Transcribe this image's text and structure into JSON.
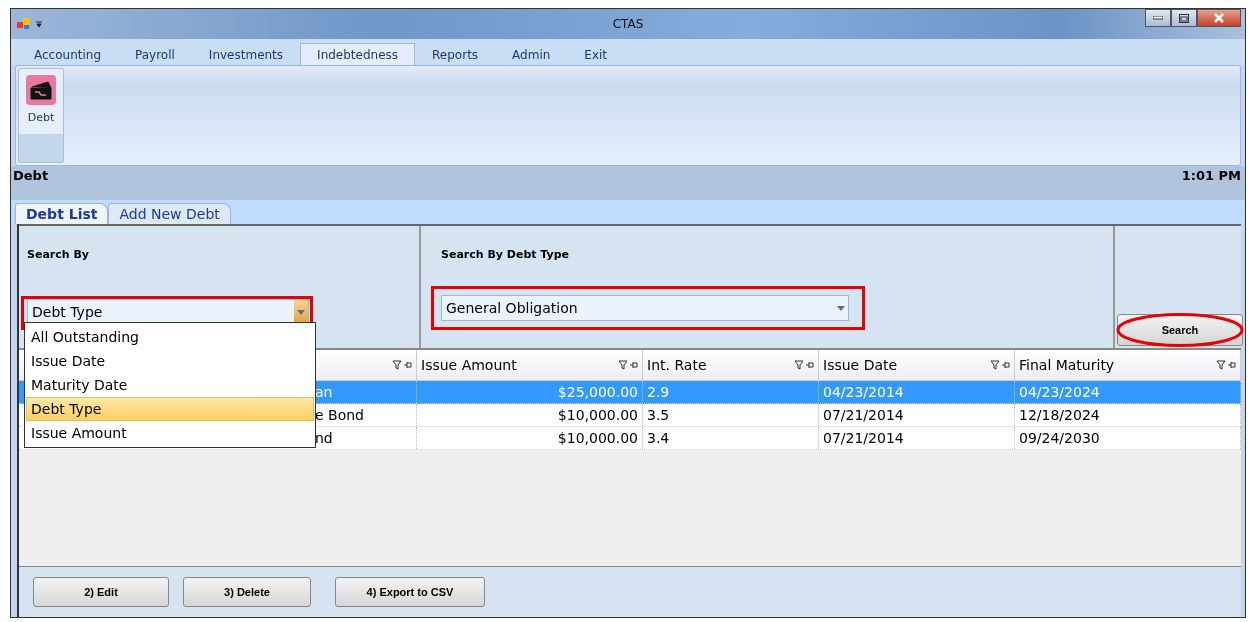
{
  "window": {
    "title": "CTAS"
  },
  "menu_tabs": [
    {
      "label": "Accounting",
      "selected": false
    },
    {
      "label": "Payroll",
      "selected": false
    },
    {
      "label": "Investments",
      "selected": false
    },
    {
      "label": "Indebtedness",
      "selected": true
    },
    {
      "label": "Reports",
      "selected": false
    },
    {
      "label": "Admin",
      "selected": false
    },
    {
      "label": "Exit",
      "selected": false
    }
  ],
  "ribbon": {
    "buttons": [
      {
        "label": "Debt"
      }
    ]
  },
  "header": {
    "title": "Debt",
    "time": "1:01 PM"
  },
  "tabs": [
    {
      "label": "Debt List",
      "selected": true
    },
    {
      "label": "Add New Debt",
      "selected": false
    }
  ],
  "search_by": {
    "label": "Search By",
    "value": "Debt Type",
    "highlighted": true,
    "expanded": true,
    "options": [
      {
        "label": "All Outstanding",
        "selected": false
      },
      {
        "label": "Issue Date",
        "selected": false
      },
      {
        "label": "Maturity Date",
        "selected": false
      },
      {
        "label": "Debt Type",
        "selected": true
      },
      {
        "label": "Issue Amount",
        "selected": false
      }
    ]
  },
  "search_by_debt_type": {
    "label": "Search By Debt Type",
    "value": "General Obligation",
    "highlighted": true
  },
  "search_button": {
    "label": "Search",
    "highlighted": true
  },
  "table": {
    "columns": [
      "",
      "Issue Amount",
      "Int. Rate",
      "Issue Date",
      "Final Maturity"
    ],
    "rows": [
      {
        "selected": true,
        "cells": [
          "an",
          "$25,000.00",
          "2.9",
          "04/23/2014",
          "04/23/2024"
        ]
      },
      {
        "selected": false,
        "cells": [
          "e Bond",
          "$10,000.00",
          "3.5",
          "07/21/2014",
          "12/18/2024"
        ]
      },
      {
        "selected": false,
        "cells": [
          "nd",
          "$10,000.00",
          "3.4",
          "07/21/2014",
          "09/24/2030"
        ]
      }
    ]
  },
  "footer_buttons": [
    "2) Edit",
    "3) Delete",
    "4) Export to CSV"
  ]
}
